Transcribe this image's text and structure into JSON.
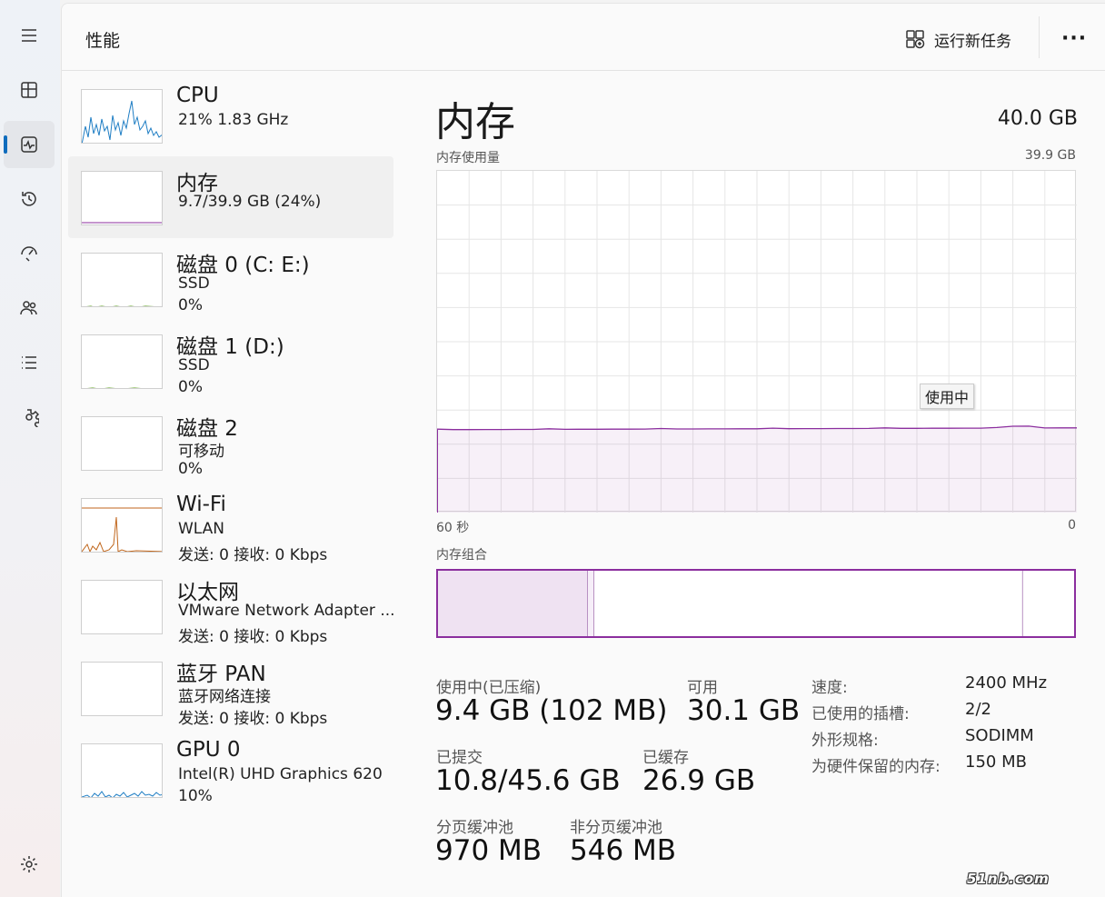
{
  "header": {
    "title": "性能",
    "run_task": "运行新任务",
    "more": "···"
  },
  "devices": [
    {
      "name": "CPU",
      "line1": "21%  1.83 GHz",
      "line2": "",
      "color": "#1f7ec4"
    },
    {
      "name": "内存",
      "line1": "9.7/39.9 GB (24%)",
      "line2": "",
      "color": "#8b2e9e"
    },
    {
      "name": "磁盘 0 (C: E:)",
      "line1": "SSD",
      "line2": "0%",
      "color": "#4e9a06"
    },
    {
      "name": "磁盘 1 (D:)",
      "line1": "SSD",
      "line2": "0%",
      "color": "#4e9a06"
    },
    {
      "name": "磁盘 2",
      "line1": "可移动",
      "line2": "0%",
      "color": "#4e9a06"
    },
    {
      "name": "Wi-Fi",
      "line1": "WLAN",
      "line2": "发送: 0  接收: 0 Kbps",
      "color": "#c0661c"
    },
    {
      "name": "以太网",
      "line1": "VMware Network Adapter ...",
      "line2": "发送: 0  接收: 0 Kbps",
      "color": "#c0661c"
    },
    {
      "name": "蓝牙 PAN",
      "line1": "蓝牙网络连接",
      "line2": "发送: 0  接收: 0 Kbps",
      "color": "#c0661c"
    },
    {
      "name": "GPU 0",
      "line1": "Intel(R) UHD Graphics 620",
      "line2": "10%",
      "color": "#1f7ec4"
    }
  ],
  "detail": {
    "title": "内存",
    "total": "40.0 GB",
    "usage_label": "内存使用量",
    "usage_max": "39.9 GB",
    "axis_left": "60 秒",
    "axis_right": "0",
    "tooltip": "使用中",
    "composition_label": "内存组合",
    "usage_fraction": 0.24,
    "composition": {
      "in_use_fraction": 0.235,
      "modified_fraction": 0.01,
      "standby_fraction": 0.674
    }
  },
  "stats": {
    "in_use_label": "使用中(已压缩)",
    "in_use_value": "9.4 GB (102 MB)",
    "available_label": "可用",
    "available_value": "30.1 GB",
    "committed_label": "已提交",
    "committed_value": "10.8/45.6 GB",
    "cached_label": "已缓存",
    "cached_value": "26.9 GB",
    "paged_label": "分页缓冲池",
    "paged_value": "970 MB",
    "nonpaged_label": "非分页缓冲池",
    "nonpaged_value": "546 MB"
  },
  "specs": [
    {
      "key": "速度:",
      "value": "2400 MHz"
    },
    {
      "key": "已使用的插槽:",
      "value": "2/2"
    },
    {
      "key": "外形规格:",
      "value": "SODIMM"
    },
    {
      "key": "为硬件保留的内存:",
      "value": "150 MB"
    }
  ],
  "watermark": "51nb.com",
  "colors": {
    "memory": "#8b2e9e",
    "accent": "#0f6cbd"
  }
}
